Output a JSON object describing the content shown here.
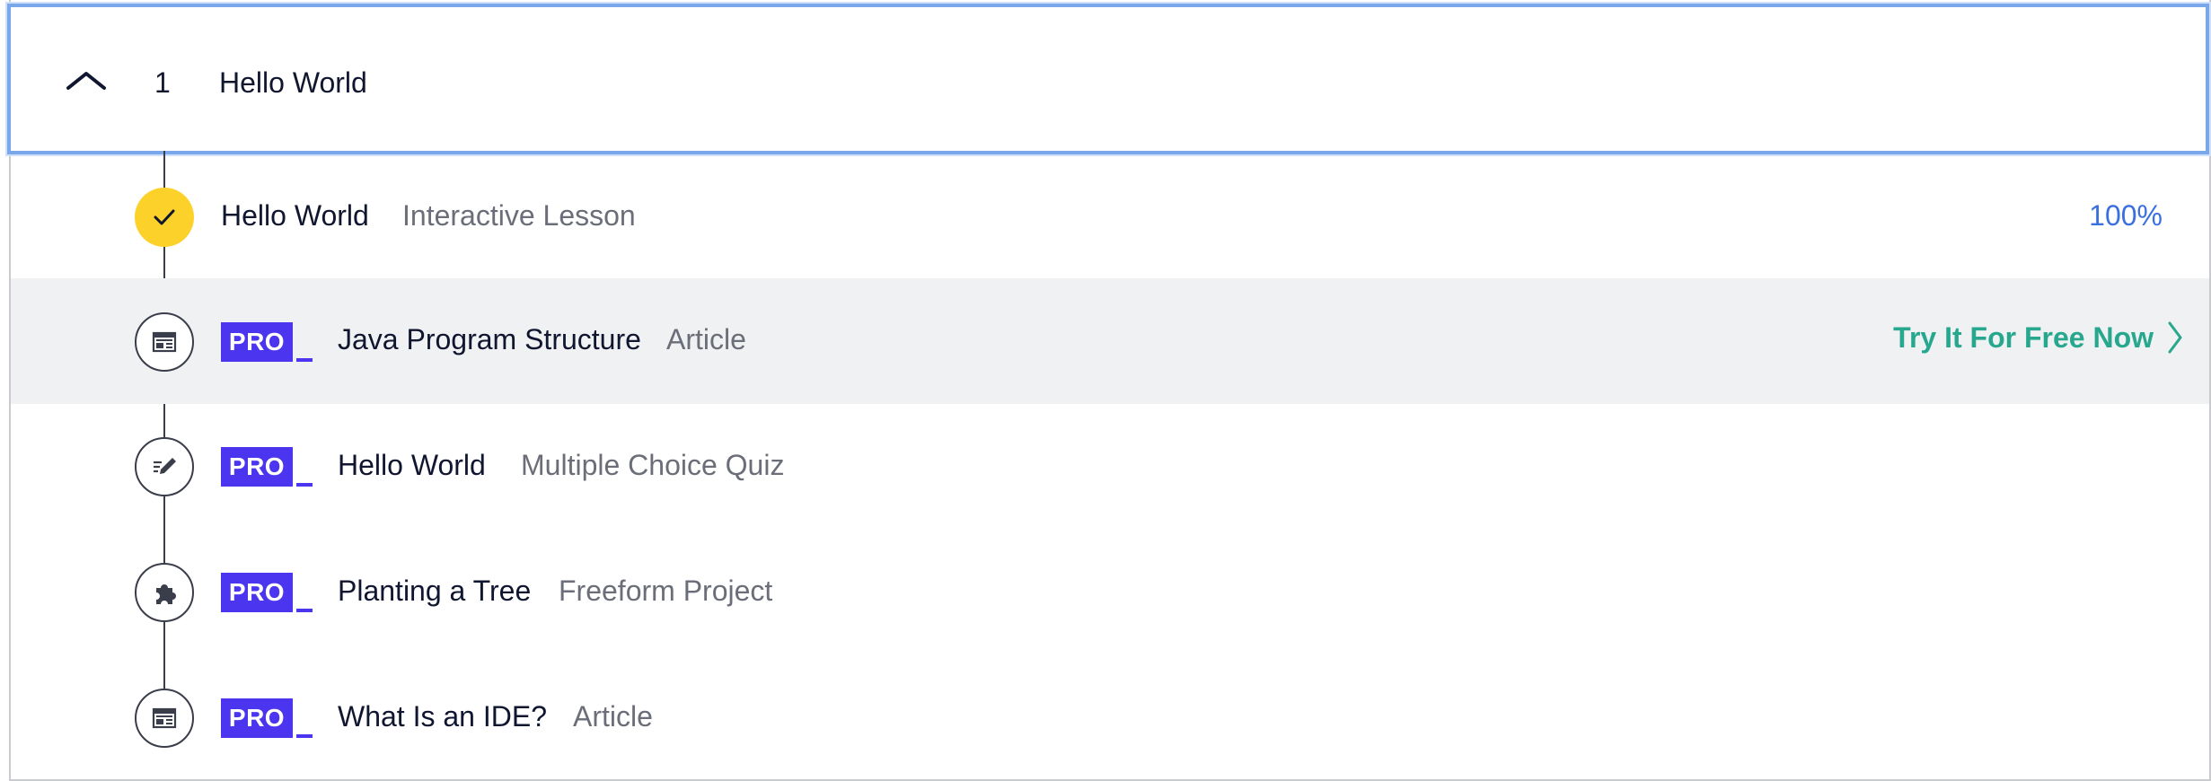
{
  "module": {
    "number": "1",
    "title": "Hello World"
  },
  "items": [
    {
      "title": "Hello World",
      "type": "Interactive Lesson",
      "icon": "check-icon",
      "completed": true,
      "progress": "100%",
      "pro": false
    },
    {
      "title": "Java Program Structure",
      "type": "Article",
      "icon": "article-icon",
      "completed": false,
      "pro": true,
      "pro_label": "PRO",
      "cta": "Try It For Free Now"
    },
    {
      "title": "Hello World",
      "type": "Multiple Choice Quiz",
      "icon": "quiz-pencil-icon",
      "completed": false,
      "pro": true,
      "pro_label": "PRO"
    },
    {
      "title": "Planting a Tree",
      "type": "Freeform Project",
      "icon": "puzzle-piece-icon",
      "completed": false,
      "pro": true,
      "pro_label": "PRO"
    },
    {
      "title": "What Is an IDE?",
      "type": "Article",
      "icon": "article-icon",
      "completed": false,
      "pro": true,
      "pro_label": "PRO"
    }
  ],
  "colors": {
    "accent_blue": "#3a6fe0",
    "pro_purple": "#4b35ef",
    "check_yellow": "#fcd12a",
    "cta_green": "#27a88e",
    "focus_border": "#7aa6ea"
  }
}
